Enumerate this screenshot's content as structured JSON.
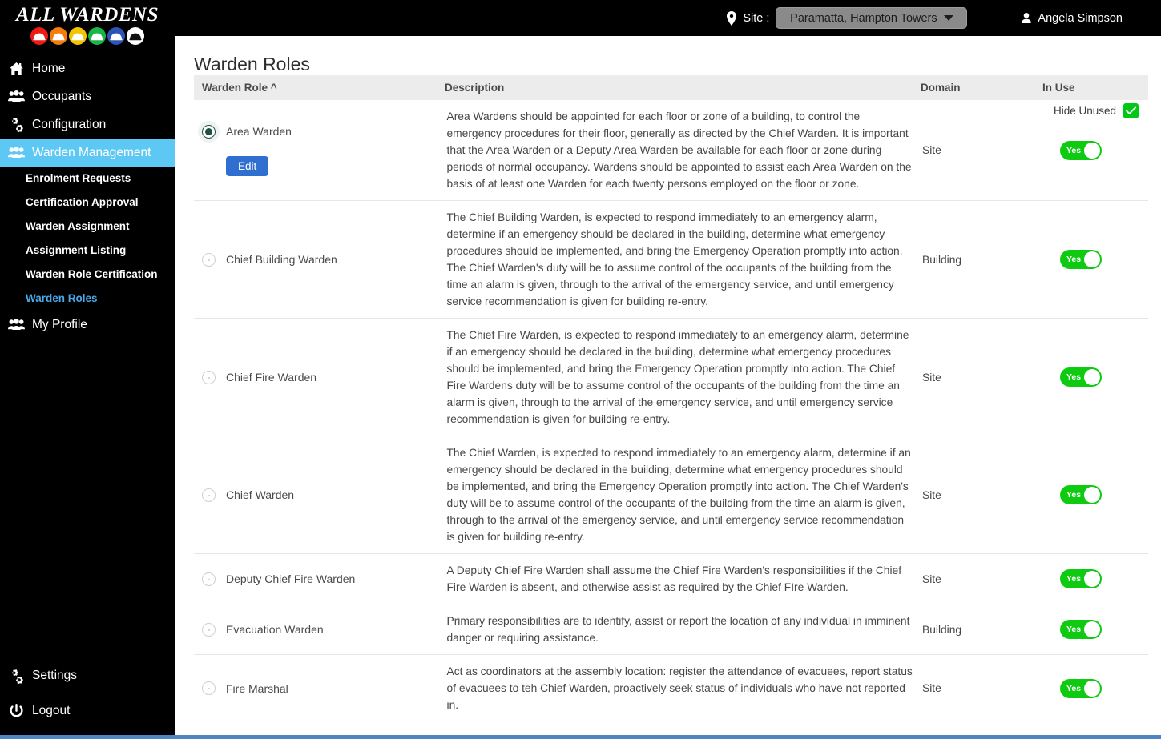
{
  "brand": {
    "title": "ALL WARDENS",
    "helmet_colors": [
      "#ee1b12",
      "#f57c0a",
      "#f5c400",
      "#18b649",
      "#2d55b8",
      "#ffffff"
    ]
  },
  "topbar": {
    "site_label": "Site :",
    "site_value": "Paramatta, Hampton Towers",
    "user_name": "Angela Simpson",
    "pin_icon": "location-pin-icon",
    "user_icon": "user-icon",
    "caret_icon": "chevron-down-icon"
  },
  "sidebar": {
    "items": [
      {
        "label": "Home",
        "icon": "home-icon"
      },
      {
        "label": "Occupants",
        "icon": "people-icon"
      },
      {
        "label": "Configuration",
        "icon": "gears-icon"
      },
      {
        "label": "Warden Management",
        "icon": "people-icon",
        "active": true
      },
      {
        "label": "My Profile",
        "icon": "people-icon"
      }
    ],
    "sub_items": [
      {
        "label": "Enrolment Requests"
      },
      {
        "label": "Certification Approval"
      },
      {
        "label": "Warden Assignment"
      },
      {
        "label": "Assignment Listing"
      },
      {
        "label": "Warden Role Certification"
      },
      {
        "label": "Warden Roles",
        "current": true
      }
    ],
    "bottom_items": [
      {
        "label": "Settings",
        "icon": "gears-icon"
      },
      {
        "label": "Logout",
        "icon": "power-icon"
      }
    ],
    "active_color": "#5ec8f5",
    "current_color": "#4aa8e8"
  },
  "main": {
    "page_title": "Warden Roles",
    "hide_unused_label": "Hide Unused",
    "hide_unused_checked": true,
    "check_icon": "check-icon",
    "check_color": "#00c814",
    "edit_button_label": "Edit",
    "edit_button_color": "#2f6fd0",
    "columns": {
      "role": "Warden Role",
      "role_sort": "^",
      "description": "Description",
      "domain": "Domain",
      "in_use": "In Use"
    },
    "rows": [
      {
        "role": "Area Warden",
        "selected": true,
        "description": "Area Wardens should be appointed for each floor or zone of a building, to control the emergency procedures for their floor, generally as directed by the Chief Warden. It is important that the Area Warden or a Deputy Area Warden be available for each floor or zone during periods of normal occupancy. Wardens should be appointed to assist each Area Warden on the basis of at least one Warden for each twenty persons employed on the floor or zone.",
        "domain": "Site",
        "in_use": "Yes",
        "has_edit": true
      },
      {
        "role": "Chief Building Warden",
        "selected": false,
        "description": "The Chief Building Warden, is expected to respond immediately to an emergency alarm, determine if an emergency should be declared in the building, determine what emergency procedures should be implemented, and bring the Emergency Operation promptly into action. The Chief Warden's duty will be to assume control of the occupants of the building from the time an alarm is given, through to the arrival of the emergency service, and until emergency service recommendation is given for building re-entry.",
        "domain": "Building",
        "in_use": "Yes",
        "has_edit": false
      },
      {
        "role": "Chief Fire Warden",
        "selected": false,
        "description": "The Chief Fire Warden, is expected to respond immediately to an emergency alarm, determine if an emergency should be declared in the building, determine what emergency procedures should be implemented, and bring the Emergency Operation promptly into action. The Chief Fire Wardens duty will be to assume control of the occupants of the building from the time an alarm is given, through to the arrival of the emergency service, and until emergency service recommendation is given for building re-entry.",
        "domain": "Site",
        "in_use": "Yes",
        "has_edit": false
      },
      {
        "role": "Chief Warden",
        "selected": false,
        "description": "The Chief Warden, is expected to respond immediately to an emergency alarm, determine if an emergency should be declared in the building, determine what emergency procedures should be implemented, and bring the Emergency Operation promptly into action. The Chief Warden's duty will be to assume control of the occupants of the building from the time an alarm is given, through to the arrival of the emergency service, and until emergency service recommendation is given for building re-entry.",
        "domain": "Site",
        "in_use": "Yes",
        "has_edit": false
      },
      {
        "role": "Deputy Chief Fire Warden",
        "selected": false,
        "description": "A Deputy Chief Fire Warden shall assume the Chief Fire Warden's responsibilities if the Chief Fire Warden is absent, and otherwise assist as required by the Chief FIre Warden.",
        "domain": "Site",
        "in_use": "Yes",
        "has_edit": false
      },
      {
        "role": "Evacuation Warden",
        "selected": false,
        "description": "Primary responsibilities are to identify, assist or report the location of any individual in imminent danger or requiring assistance.",
        "domain": "Building",
        "in_use": "Yes",
        "has_edit": false
      },
      {
        "role": "Fire Marshal",
        "selected": false,
        "description": "Act as coordinators at the assembly location: register the attendance of evacuees, report status of evacuees to teh Chief Warden, proactively seek status of individuals who have not reported in.",
        "domain": "Site",
        "in_use": "Yes",
        "has_edit": false
      }
    ]
  }
}
